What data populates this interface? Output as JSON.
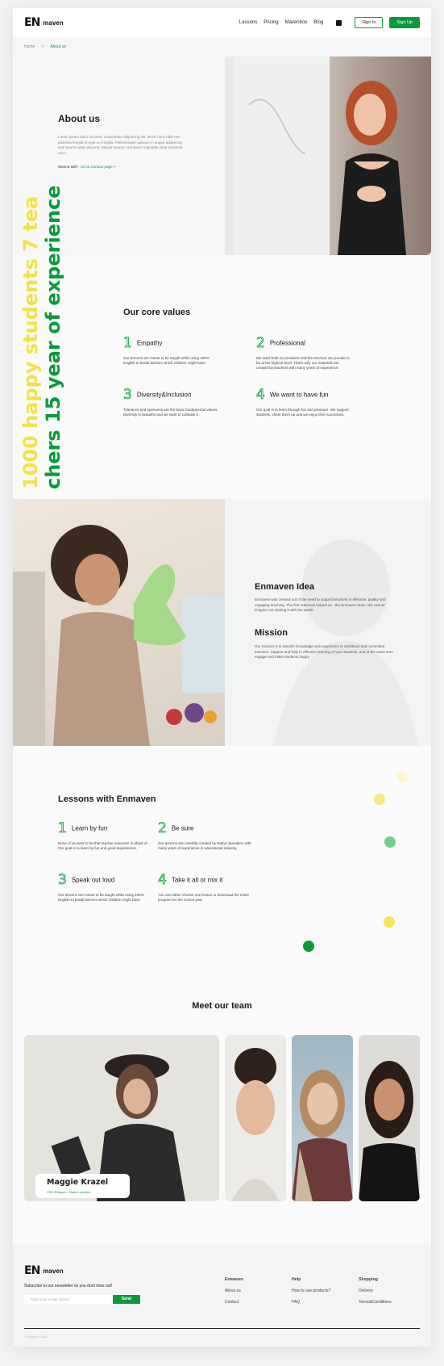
{
  "header": {
    "logo_mark": "EN",
    "logo_word": "maven",
    "nav": [
      "Lessons",
      "Pricing",
      "Mavenbox",
      "Blog"
    ],
    "signin": "Sign In",
    "signup": "Sign Up"
  },
  "breadcrumb": {
    "home": "Home",
    "sep": ">",
    "current": "About us"
  },
  "about": {
    "title": "About us",
    "text": "Lorem ipsum dolor sit amet, consectetur adipiscing elit. Morbi nunc nibh nec pharetra feugiat et eget eu fringilla. Pellentesque quisque in augue adipiscing sed mauris turpis placerat. Massa mauris, sed ipsum vulputate vitae hendrerit nunc.",
    "talk": "Wanna talk?",
    "talk_link": "Go to Contact page  >"
  },
  "vertical": {
    "line1": "1000 happy students 7 tea",
    "line2": "chers 15 year of experience"
  },
  "core_values": {
    "title": "Our core values",
    "items": [
      {
        "num": "1",
        "title": "Empathy",
        "text": "Our lessons are meant to be taught while using 100% English to break barriers which children might have"
      },
      {
        "num": "2",
        "title": "Professional",
        "text": "We want both our products and the services we provide to be at the highest level. That's why our materials are created by teachers with many years of experience."
      },
      {
        "num": "3",
        "title": "Diversity&Inclusion",
        "text": "Tolerance and openness are the basic fundamental values. Diversity is beautiful and we want to cultivate it."
      },
      {
        "num": "4",
        "title": "We want to have fun",
        "text": "Our goal is to learn through fun and pleasure. We support students, cheer them up and we enjoy their successes."
      }
    ]
  },
  "idea": {
    "title": "Enmaven Idea",
    "text": "Enmaven was created out of the need to support teachers in effective, quality and engaging teaching. The first materials helped us - the Enmaven team. We cannot imagine not sharing it with the world!",
    "mission_title": "Mission",
    "mission_text": "Our mission is to transfer knowledge and experience to ambitious and committed teachers. Support and help in effective learning of your students, and at the same time engage and make students happy."
  },
  "lessons": {
    "title": "Lessons with Enmaven",
    "items": [
      {
        "num": "1",
        "title": "Learn by fun",
        "text": "None of us want to be that teacher everyone is afraid of. Our goal is to learn by fun and good experiences."
      },
      {
        "num": "2",
        "title": "Be sure",
        "text": "Our lessons are carefully created by Native Speakers with many years of experience in educational industry."
      },
      {
        "num": "3",
        "title": "Speak out loud",
        "text": "Our lessons are meant to be taught while using 100% English to break barriers which children might have"
      },
      {
        "num": "4",
        "title": "Take it all or mix it",
        "text": "You can either choose one lesson or download the entire program for the school year."
      }
    ]
  },
  "team": {
    "title": "Meet our team",
    "name": "Maggie Krazel",
    "role": "CEO EMaven  •  Native speaker"
  },
  "footer": {
    "subscribe": "Subscribe to our newsletter so you dont miss out!",
    "placeholder": "Type your e-mail adress",
    "send": "Send",
    "cols": [
      {
        "h": "Enmaven",
        "items": [
          "About us",
          "Contact"
        ]
      },
      {
        "h": "Help",
        "items": [
          "How to use products?",
          "FAQ"
        ]
      },
      {
        "h": "Shopping",
        "items": [
          "Delivery",
          "Terms&Conditions"
        ]
      }
    ],
    "copy": "© EMaven, 2022"
  },
  "colors": {
    "accent": "#0a9a3a",
    "yellow": "#f5e35a",
    "light_green": "#6fd08a"
  }
}
